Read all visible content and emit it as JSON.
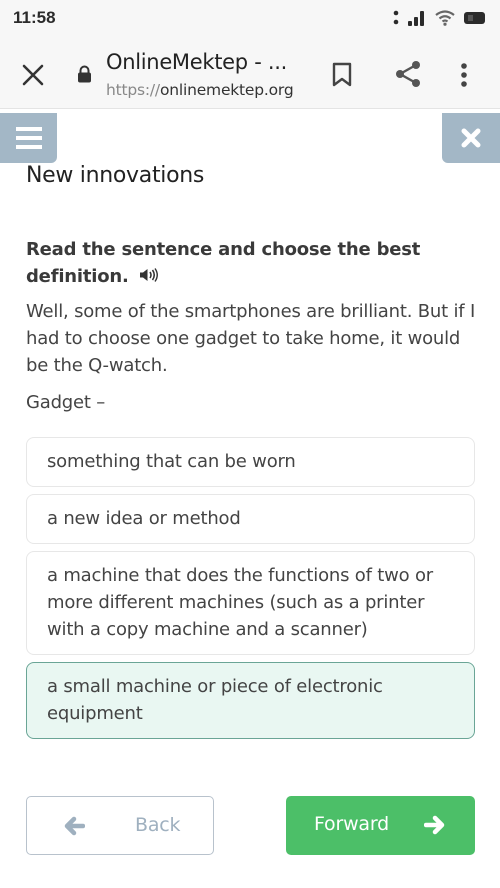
{
  "status_bar": {
    "time": "11:58",
    "icons": [
      "signal-dots-icon",
      "cell-signal-icon",
      "wifi-icon",
      "battery-icon"
    ]
  },
  "browser": {
    "page_title": "OnlineMektep - ...",
    "url_scheme": "https://",
    "url_host": "onlinemektep.org",
    "icons": [
      "close-icon",
      "lock-icon",
      "bookmark-icon",
      "share-icon",
      "more-vert-icon"
    ]
  },
  "toolbar": {
    "menu_icon": "hamburger-icon",
    "close_icon": "close-icon",
    "accent_color": "#a3b7c6"
  },
  "lesson": {
    "title": "New innovations"
  },
  "task": {
    "instruction": "Read the sentence and choose the best definition.",
    "audio_icon": "speaker-icon",
    "sentence": "Well, some of the smartphones are brilliant. But if I had to choose one gadget to take home, it would be the Q-watch.",
    "prompt": "Gadget –",
    "options": [
      {
        "label": "something that can be worn",
        "selected": false
      },
      {
        "label": "a new idea or method",
        "selected": false
      },
      {
        "label": "a machine that does the functions of two or more different machines (such as a printer with a copy machine and a scanner)",
        "selected": false
      },
      {
        "label": "a small machine or piece of electronic equipment",
        "selected": true
      }
    ],
    "selected_color": "#e9f7f2"
  },
  "navigation": {
    "back_label": "Back",
    "forward_label": "Forward",
    "forward_color": "#4cbf68"
  }
}
